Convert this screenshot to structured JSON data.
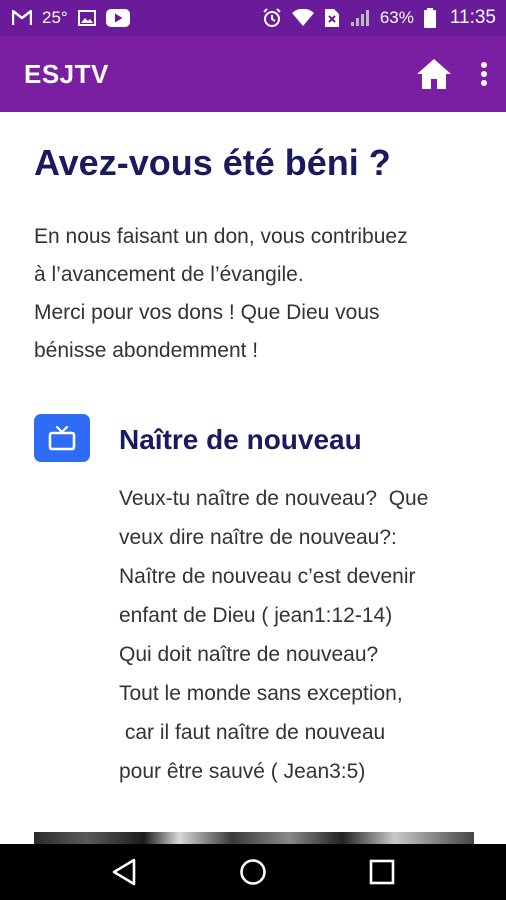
{
  "status_bar": {
    "temperature": "25°",
    "battery": "63%",
    "time": "11:35",
    "left_icons": [
      "gmail-icon",
      "weather-icon",
      "image-icon",
      "youtube-icon"
    ],
    "right_icons": [
      "alarm-icon",
      "wifi-icon",
      "no-sim-icon",
      "signal-icon",
      "battery-icon"
    ]
  },
  "app_bar": {
    "title": "ESJTV",
    "background": "#7b1fa2",
    "actions": [
      "home-icon",
      "more-vert-icon"
    ]
  },
  "content": {
    "title": "Avez-vous été béni ?",
    "intro_lines": [
      "En nous faisant un don, vous contribuez",
      "à l’avancement de l’évangile.",
      "Merci pour vos dons ! Que Dieu vous",
      "bénisse abondemment !"
    ],
    "feature": {
      "icon": "tv-icon",
      "icon_color": "#2e6cf5",
      "title": "Naître de nouveau",
      "lines": [
        "Veux-tu naître de nouveau?  Que",
        "veux dire naître de nouveau?:",
        "Naître de nouveau c’est devenir",
        "enfant de Dieu ( jean1:12-14)",
        "Qui doit naître de nouveau?",
        "Tout le monde sans exception,",
        " car il faut naître de nouveau",
        "pour être sauvé ( Jean3:5)"
      ]
    }
  },
  "nav_bar": {
    "buttons": [
      "back-icon",
      "home-circle-icon",
      "recents-icon"
    ]
  }
}
